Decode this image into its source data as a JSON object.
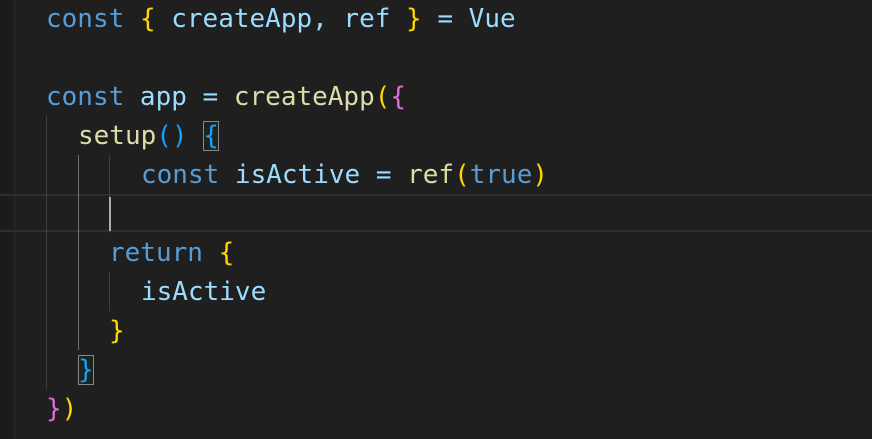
{
  "code": {
    "l1": {
      "kw": "const",
      "open": "{",
      "names": " createApp, ref ",
      "close": "}",
      "rest": " = Vue"
    },
    "l3": {
      "kw": "const",
      "mid": " app = ",
      "fn": "createApp",
      "p": "(",
      "b": "{"
    },
    "l4": {
      "fn": "setup",
      "parens": "()",
      "b": "{"
    },
    "l5": {
      "kw": "const",
      "var": " isActive = ",
      "fn": "ref",
      "p": "(",
      "val": "true",
      "pc": ")"
    },
    "l7": {
      "kw": "return",
      "b": "{"
    },
    "l8": {
      "text": "isActive"
    },
    "l9": {
      "b": "}"
    },
    "l10": {
      "b": "}"
    },
    "l11": {
      "b": "}",
      "p": ")"
    }
  }
}
